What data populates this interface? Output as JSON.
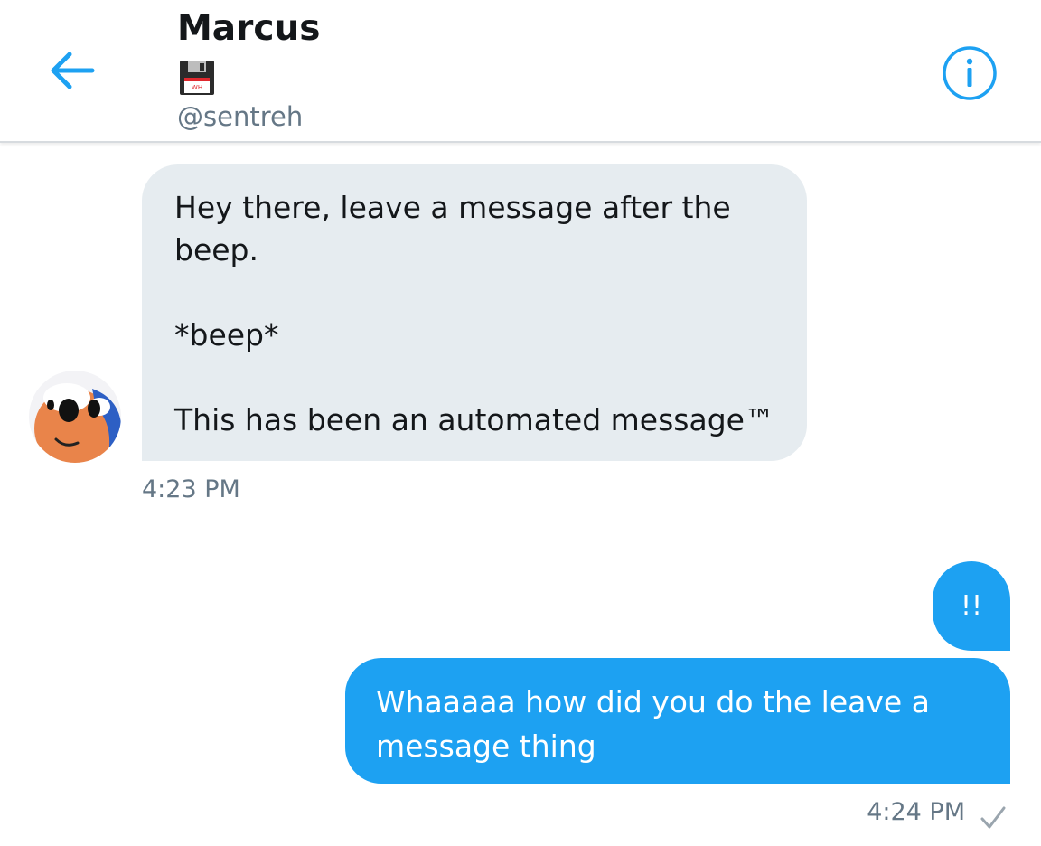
{
  "header": {
    "title": "Marcus",
    "title_emoji": "floppy-disk-icon",
    "floppy_label": "WH",
    "handle": "@sentreh",
    "back_icon": "arrow-left-icon",
    "info_icon": "info-icon"
  },
  "colors": {
    "accent": "#1da1f2",
    "incoming_bubble": "#e6ecf0",
    "muted_text": "#657786"
  },
  "messages": [
    {
      "direction": "incoming",
      "text": "Hey there, leave a message after the\nbeep.\n\n*beep*\n\nThis has been an automated message™",
      "time": "4:23 PM"
    },
    {
      "direction": "outgoing",
      "text": "!!"
    },
    {
      "direction": "outgoing",
      "text": "Whaaaaa how did you do the leave a message thing",
      "time": "4:24 PM",
      "status_icon": "checkmark-icon"
    }
  ]
}
